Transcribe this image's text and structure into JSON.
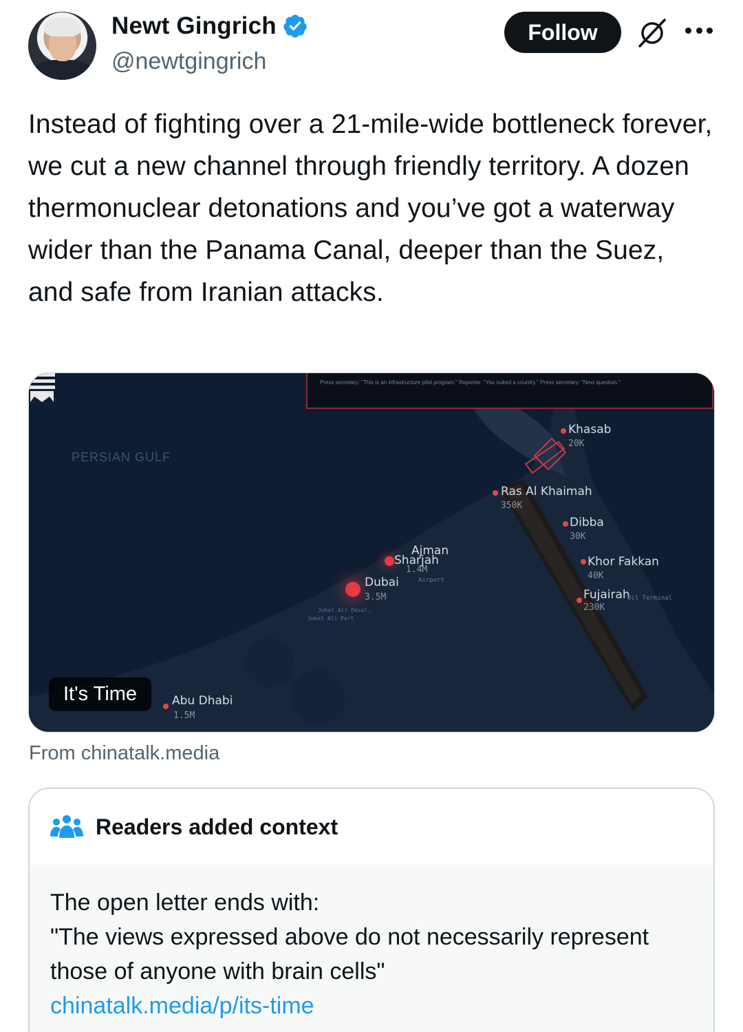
{
  "author": {
    "name": "Newt Gingrich",
    "handle": "@newtgingrich",
    "verified": true
  },
  "actions": {
    "follow_label": "Follow"
  },
  "tweet": {
    "text": "Instead of fighting over a 21-mile-wide bottleneck forever, we cut a new channel through friendly territory. A dozen thermonuclear detonations and you’ve got a waterway wider than the Panama Canal, deeper than the Suez, and safe from Iranian attacks."
  },
  "media": {
    "badge": "It's Time",
    "press_text": "Press secretary: \"This is an infrastructure pilot program.\" Reporter: \"You nuked a country.\" Press secretary: \"Next question.\"",
    "region_label": "PERSIAN GULF",
    "cities": [
      {
        "name": "Khasab",
        "pop": "20K"
      },
      {
        "name": "Ras Al Khaimah",
        "pop": "350K"
      },
      {
        "name": "Dibba",
        "pop": "30K"
      },
      {
        "name": "Khor Fakkan",
        "pop": "40K"
      },
      {
        "name": "Fujairah",
        "pop": "230K"
      },
      {
        "name": "Ajman",
        "pop": ""
      },
      {
        "name": "Sharjah",
        "pop": "1.4M"
      },
      {
        "name": "Dubai",
        "pop": "3.5M"
      },
      {
        "name": "Abu Dhabi",
        "pop": "1.5M"
      }
    ],
    "small_labels": [
      "Jebel Ali Desal.",
      "Jebel Ali Port",
      "Airport",
      "Oil Terminal"
    ]
  },
  "source": {
    "text": "From chinatalk.media"
  },
  "community_note": {
    "title": "Readers added context",
    "line1": "The open letter ends with:",
    "line2": "\"The views expressed above do not necessarily represent those of anyone with brain cells\"",
    "link": "chinatalk.media/p/its-time"
  },
  "colors": {
    "follow_bg": "#0f1419",
    "verified": "#1d9bf0",
    "link": "#1d9bf0",
    "secondary_text": "#536471"
  }
}
